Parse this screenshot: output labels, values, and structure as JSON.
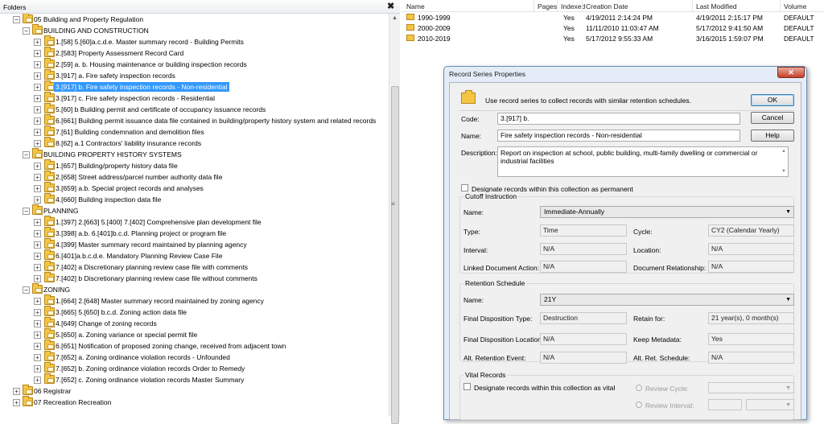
{
  "left_panel": {
    "header": "Folders",
    "close_glyph": "✖",
    "tree": [
      {
        "level": 1,
        "label": "05 Building and Property Regulation",
        "expanded": true
      },
      {
        "level": 2,
        "label": "BUILDING AND CONSTRUCTION",
        "expanded": true
      },
      {
        "level": 3,
        "label": "1.[58] 5.[60]a.c.d.e. Master summary record - Building Permits"
      },
      {
        "level": 3,
        "label": "2.[583] Property Assessment Record Card"
      },
      {
        "level": 3,
        "label": "2.[59] a. b. Housing maintenance or building inspection records"
      },
      {
        "level": 3,
        "label": "3.[917] a. Fire safety inspection records"
      },
      {
        "level": 3,
        "label": "3.[917] b. Fire safety inspection records - Non-residential",
        "selected": true
      },
      {
        "level": 3,
        "label": "3.[917] c. Fire safety inspection records - Residential"
      },
      {
        "level": 3,
        "label": "5.[60] b Building permit and certificate of occupancy issuance records"
      },
      {
        "level": 3,
        "label": "6.[661] Building permit issuance data file contained in building/property history system and related records"
      },
      {
        "level": 3,
        "label": "7.[61] Building condemnation and demolition files"
      },
      {
        "level": 3,
        "label": "8.[62] a.1 Contractors' liability insurance records"
      },
      {
        "level": 2,
        "label": "BUILDING PROPERTY HISTORY SYSTEMS",
        "expanded": true
      },
      {
        "level": 3,
        "label": "1.[657] Building/property history data file"
      },
      {
        "level": 3,
        "label": "2.[658] Street address/parcel number authority data file"
      },
      {
        "level": 3,
        "label": "3.[659] a.b. Special project records and analyses"
      },
      {
        "level": 3,
        "label": "4.[660] Building inspection data file"
      },
      {
        "level": 2,
        "label": "PLANNING",
        "expanded": true
      },
      {
        "level": 3,
        "label": "1.[397] 2.[663] 5.[400] 7.[402] Comprehensive plan development file"
      },
      {
        "level": 3,
        "label": "3.[398] a.b. 6.[401]b.c.d. Planning project or program file"
      },
      {
        "level": 3,
        "label": "4.[399] Master summary record maintained by planning agency"
      },
      {
        "level": 3,
        "label": "6.[401]a.b.c.d.e. Mandatory Planning Review Case File"
      },
      {
        "level": 3,
        "label": "7.[402] a Discretionary planning review case file with comments"
      },
      {
        "level": 3,
        "label": "7.[402] b Discretionary planning review case file without comments"
      },
      {
        "level": 2,
        "label": "ZONING",
        "expanded": true
      },
      {
        "level": 3,
        "label": "1.[664] 2.[648] Master summary record maintained by zoning agency"
      },
      {
        "level": 3,
        "label": "3.[665] 5.[650] b.c.d. Zoning action data file"
      },
      {
        "level": 3,
        "label": "4.[649] Change of zoning records"
      },
      {
        "level": 3,
        "label": "5.[650] a. Zoning variance or special permit file"
      },
      {
        "level": 3,
        "label": "6.[651] Notification of proposed zoning change, received from adjacent town"
      },
      {
        "level": 3,
        "label": "7.[652] a. Zoning ordinance violation records - Unfounded"
      },
      {
        "level": 3,
        "label": "7.[652] b. Zoning ordinance violation records Order to Remedy"
      },
      {
        "level": 3,
        "label": "7.[652] c. Zoning ordinance violation records  Master Summary"
      },
      {
        "level": 1,
        "label": "06 Registrar",
        "expanded": false
      },
      {
        "level": 1,
        "label": "07 Recreation Recreation",
        "expanded": false
      }
    ]
  },
  "right_panel": {
    "columns": [
      "Name",
      "Pages",
      "Indexed",
      "Creation Date",
      "Last Modified",
      "Volume"
    ],
    "rows": [
      {
        "name": "1990-1999",
        "pages": "",
        "indexed": "Yes",
        "created": "4/19/2011 2:14:24 PM",
        "modified": "4/19/2011 2:15:17 PM",
        "volume": "DEFAULT"
      },
      {
        "name": "2000-2009",
        "pages": "",
        "indexed": "Yes",
        "created": "11/11/2010 11:03:47 AM",
        "modified": "5/17/2012 9:41:50 AM",
        "volume": "DEFAULT"
      },
      {
        "name": "2010-2019",
        "pages": "",
        "indexed": "Yes",
        "created": "5/17/2012 9:55:33 AM",
        "modified": "3/16/2015 1:59:07 PM",
        "volume": "DEFAULT"
      }
    ]
  },
  "dialog": {
    "title": "Record Series Properties",
    "close_glyph": "✕",
    "intro": "Use record series to collect records with similar retention schedules.",
    "ok": "OK",
    "cancel": "Cancel",
    "help": "Help",
    "code_label": "Code:",
    "code_value": "3.[917] b.",
    "name_label": "Name:",
    "name_value": "Fire safety inspection records - Non-residential",
    "desc_label": "Description:",
    "desc_value": "Report on inspection at school, public building, multi-family dwelling or commercial or industrial facilities",
    "permanent_label": "Designate records within this collection as permanent",
    "cutoff": {
      "title": "Cutoff Instruction",
      "name_label": "Name:",
      "name_value": "Immediate-Annually",
      "type_label": "Type:",
      "type_value": "Time",
      "cycle_label": "Cycle:",
      "cycle_value": "CY2 (Calendar Yearly)",
      "interval_label": "Interval:",
      "interval_value": "N/A",
      "location_label": "Location:",
      "location_value": "N/A",
      "linked_label": "Linked Document Action:",
      "linked_value": "N/A",
      "rel_label": "Document Relationship:",
      "rel_value": "N/A"
    },
    "retention": {
      "title": "Retention Schedule",
      "name_label": "Name:",
      "name_value": "21Y",
      "fdt_label": "Final Disposition Type:",
      "fdt_value": "Destruction",
      "retain_label": "Retain for:",
      "retain_value": "21 year(s), 0 month(s)",
      "fdl_label": "Final Disposition Location:",
      "fdl_value": "N/A",
      "keep_label": "Keep Metadata:",
      "keep_value": "Yes",
      "alt_event_label": "Alt. Retention Event:",
      "alt_event_value": "N/A",
      "alt_sched_label": "Alt. Ret. Schedule:",
      "alt_sched_value": "N/A"
    },
    "vital": {
      "title": "Vital Records",
      "vital_label": "Designate records within this collection as vital",
      "review_cycle_label": "Review Cycle:",
      "review_interval_label": "Review Interval:"
    }
  }
}
